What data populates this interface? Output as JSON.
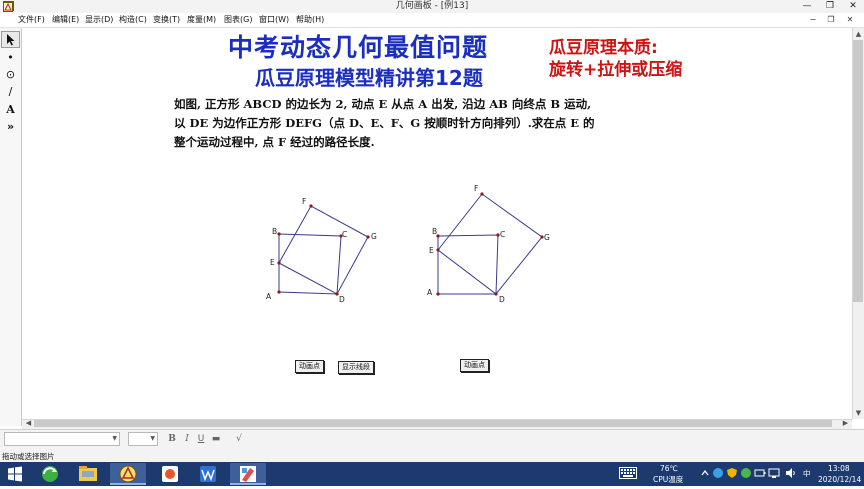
{
  "window": {
    "title": "几何画板 - [例13]",
    "minimize": "—",
    "restore": "❐",
    "close": "✕"
  },
  "menu": {
    "items": [
      "文件(F)",
      "编辑(E)",
      "显示(D)",
      "构造(C)",
      "变换(T)",
      "度量(M)",
      "图表(G)",
      "窗口(W)",
      "帮助(H)"
    ],
    "mdi_minimize": "−",
    "mdi_restore": "❐",
    "mdi_close": "✕"
  },
  "toolbox": {
    "point_glyph": "•",
    "compass_glyph": "⊙",
    "line_glyph": "∕",
    "text_glyph": "A",
    "custom_glyph": "»"
  },
  "content": {
    "title_main": "中考动态几何最值问题",
    "title_sub": "瓜豆原理模型精讲第12题",
    "note_line1": "瓜豆原理本质:",
    "note_line2": "旋转+拉伸或压缩",
    "problem_line1": "如图, 正方形 ABCD 的边长为 2, 动点 E 从点 A 出发, 沿边 AB 向终点 B 运动,",
    "problem_line2": "以 DE 为边作正方形 DEFG（点 D、E、F、G 按顺时针方向排列）.求在点 E 的",
    "problem_line3": "整个运动过程中, 点 F 经过的路径长度."
  },
  "figure_labels": {
    "A": "A",
    "B": "B",
    "C": "C",
    "D": "D",
    "E": "E",
    "F": "F",
    "G": "G"
  },
  "buttons": {
    "animate_left": "动画点",
    "show_trace": "显示线段",
    "animate_right": "动画点"
  },
  "scroll": {
    "up": "▲",
    "down": "▼",
    "left": "◀",
    "right": "▶"
  },
  "textbar": {
    "dropdown_arrow": "▼",
    "bold": "B",
    "italic": "I",
    "underline": "U",
    "color": "▬",
    "symbol": "√"
  },
  "status": {
    "text": "拖动或选择图片"
  },
  "tray": {
    "temperature": "76℃",
    "cpu_label": "CPU温度",
    "ime": "中",
    "time": "13:08",
    "date": "2020/12/14"
  },
  "colors": {
    "title_blue": "#1b2ebd",
    "note_red": "#cc1414",
    "figure_line": "#3a3a8c",
    "figure_point": "#8b1a1a",
    "taskbar": "#1d3a6e"
  }
}
